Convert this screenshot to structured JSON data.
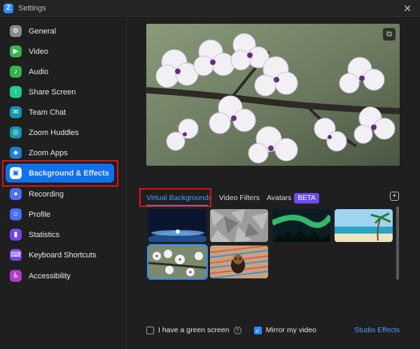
{
  "window": {
    "title": "Settings",
    "logo_letter": "Z",
    "close_symbol": "✕"
  },
  "sidebar": {
    "items": [
      {
        "label": "General",
        "icon": "gear-icon",
        "glyph": "⚙",
        "color": "#8a8a8a"
      },
      {
        "label": "Video",
        "icon": "video-icon",
        "glyph": "▶",
        "color": "#37b24d"
      },
      {
        "label": "Audio",
        "icon": "headphones-icon",
        "glyph": "♪",
        "color": "#37b24d"
      },
      {
        "label": "Share Screen",
        "icon": "share-screen-icon",
        "glyph": "↑",
        "color": "#20c997"
      },
      {
        "label": "Team Chat",
        "icon": "chat-icon",
        "glyph": "✉",
        "color": "#1098ad"
      },
      {
        "label": "Zoom Huddles",
        "icon": "huddles-icon",
        "glyph": "◎",
        "color": "#1098ad"
      },
      {
        "label": "Zoom Apps",
        "icon": "apps-icon",
        "glyph": "◈",
        "color": "#1c7ed6"
      },
      {
        "label": "Background & Effects",
        "icon": "background-effects-icon",
        "glyph": "▣",
        "color": "#ffffff"
      },
      {
        "label": "Recording",
        "icon": "recording-icon",
        "glyph": "●",
        "color": "#4c6ef5"
      },
      {
        "label": "Profile",
        "icon": "profile-icon",
        "glyph": "☺",
        "color": "#4c6ef5"
      },
      {
        "label": "Statistics",
        "icon": "statistics-icon",
        "glyph": "▮",
        "color": "#7048e8"
      },
      {
        "label": "Keyboard Shortcuts",
        "icon": "keyboard-icon",
        "glyph": "⌨",
        "color": "#7048e8"
      },
      {
        "label": "Accessibility",
        "icon": "accessibility-icon",
        "glyph": "♿",
        "color": "#ae3ec9"
      }
    ],
    "active_index": 7
  },
  "main": {
    "expand_symbol": "⧉",
    "tabs": [
      {
        "label": "Virtual Backgrounds",
        "active": true
      },
      {
        "label": "Video Filters",
        "active": false
      },
      {
        "label": "Avatars",
        "active": false
      }
    ],
    "beta_badge": "BETA",
    "add_symbol": "+",
    "thumbnails": [
      {
        "name": "earth-from-space",
        "selected": false
      },
      {
        "name": "grey-texture",
        "selected": false
      },
      {
        "name": "aurora",
        "selected": false
      },
      {
        "name": "beach-palm",
        "selected": false
      },
      {
        "name": "cherry-blossom",
        "selected": true
      },
      {
        "name": "puppy",
        "selected": false
      }
    ],
    "green_screen_label": "I have a green screen",
    "green_screen_checked": false,
    "help_symbol": "?",
    "mirror_label": "Mirror my video",
    "mirror_checked": true,
    "check_symbol": "✓",
    "studio_effects_label": "Studio Effects"
  },
  "colors": {
    "accent": "#0e72ed",
    "link": "#4a9fff",
    "highlight_box": "#d7141a",
    "beta": "#6b4cf0"
  }
}
